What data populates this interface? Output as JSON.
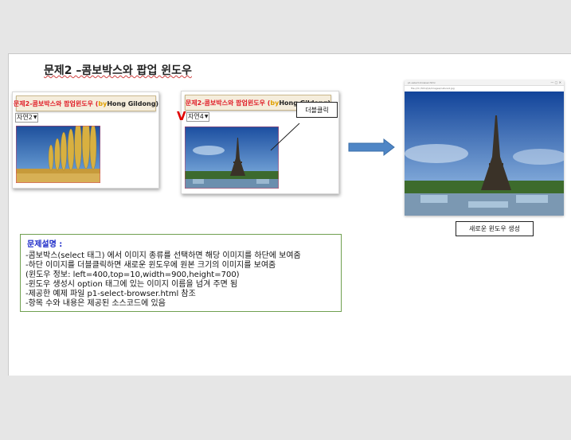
{
  "slide": {
    "title": "문제2 –콤보박스와 팝업 윈도우"
  },
  "panel_left": {
    "banner": {
      "part1": "문제2",
      "part2": "-콤보박스와 팝업윈도우 ( ",
      "part3": "by",
      "part4": " Hong Gildong)"
    },
    "select_value": "자연2",
    "image_alt": "poplar trees"
  },
  "panel_mid": {
    "banner": {
      "part1": "문제2",
      "part2": "-콤보박스와 팝업윈도우 ( ",
      "part3": "by",
      "part4": " Hong Gildong)"
    },
    "select_value": "자연4",
    "check_mark": "V",
    "callout": "더블클릭",
    "image_alt": "eiffel tower"
  },
  "popup": {
    "tab_text": "p1-select-browser.html",
    "url_text": "file:///C:/html/p1/images/nature4.jpg",
    "caption": "새로운 윈도우 생성"
  },
  "description": {
    "heading": "문제설명 :",
    "lines": [
      "-콤보박스(select 태그) 에서 이미지 종류를 선택하면 해당 이미지를 하단에 보여줌",
      "-하단 이미지를 더블클릭하면 새로운 윈도우에 원본 크기의 이미지를 보여줌",
      "(윈도우 정보:  left=400,top=10,width=900,height=700)",
      "-윈도우 생성시 option 태그에 있는 이미지 이름을 넘겨 주면 됨",
      "-제공한 예제 파일 p1-select-browser.html 참조",
      "-항목 수와 내용은 제공된 소스코드에 있음"
    ]
  },
  "colors": {
    "accent_red": "#e0202a",
    "accent_blue": "#1a28c8",
    "arrow_blue": "#4f86c6",
    "desc_border": "#70a050"
  }
}
